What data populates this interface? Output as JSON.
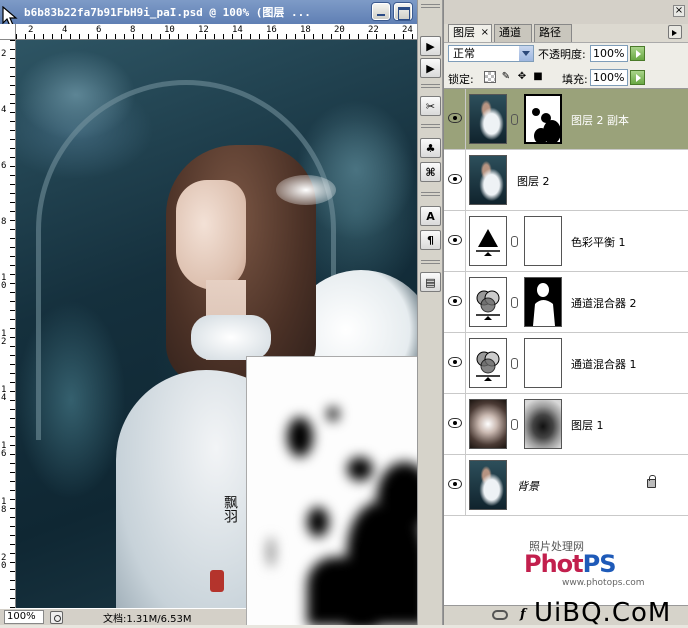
{
  "document": {
    "title": "b6b83b22fa7b91FbH9i_paI.psd @ 100% (图层 ...",
    "zoom": "100%",
    "doc_size": "文档:1.31M/6.53M",
    "ruler_top_labels": [
      "2",
      "4",
      "6",
      "8",
      "10",
      "12",
      "14",
      "16",
      "18",
      "20",
      "22",
      "24"
    ],
    "ruler_left_labels": [
      "2",
      "4",
      "6",
      "8",
      "1 0",
      "1 2",
      "1 4",
      "1 6",
      "1 8",
      "2 0"
    ],
    "calligraphy": "飘羽"
  },
  "tool_strip": {
    "tools": [
      {
        "name": "play-icon",
        "glyph": "▶"
      },
      {
        "name": "play-icon-2",
        "glyph": "▶"
      },
      {
        "name": "brush-tools-icon",
        "glyph": "✂"
      },
      {
        "name": "clone-stamp-icon",
        "glyph": "♣"
      },
      {
        "name": "history-brush-icon",
        "glyph": "⌘"
      },
      {
        "name": "character-icon",
        "glyph": "A"
      },
      {
        "name": "paragraph-icon",
        "glyph": "¶"
      },
      {
        "name": "layer-comps-icon",
        "glyph": "▤"
      }
    ]
  },
  "layers_panel": {
    "tabs": [
      "图层",
      "通道",
      "路径"
    ],
    "blend_mode": "正常",
    "opacity_label": "不透明度:",
    "opacity_value": "100%",
    "lock_label": "锁定:",
    "fill_label": "填充:",
    "fill_value": "100%",
    "layers": [
      {
        "name": "图层 2 副本",
        "selected": true,
        "thumb": "photo",
        "mask": "mask1"
      },
      {
        "name": "图层 2",
        "selected": false,
        "thumb": "photo",
        "mask": null
      },
      {
        "name": "色彩平衡 1",
        "selected": false,
        "thumb": "balance",
        "mask": "white"
      },
      {
        "name": "通道混合器 2",
        "selected": false,
        "thumb": "mixer",
        "mask": "mask2"
      },
      {
        "name": "通道混合器 1",
        "selected": false,
        "thumb": "mixer",
        "mask": "white"
      },
      {
        "name": "图层 1",
        "selected": false,
        "thumb": "radial",
        "mask": "mask3"
      },
      {
        "name": "背景",
        "selected": false,
        "thumb": "photo",
        "mask": null,
        "locked": true
      }
    ],
    "watermark_small": "照片处理网",
    "watermark_logo_a": "Phot",
    "watermark_logo_b": "PS",
    "watermark_url": "www.photops.com",
    "bottom_fx": "f",
    "uibq": "UiBQ.CoM"
  }
}
